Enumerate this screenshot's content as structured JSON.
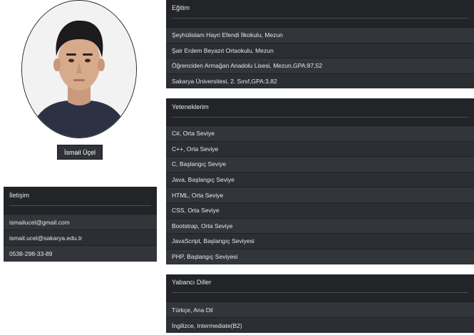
{
  "profile": {
    "name": "İsmail Üçel"
  },
  "egitim": {
    "title": "Eğitim",
    "items": [
      "Şeyhülislam Hayri Efendi İlkokulu, Mezun",
      "Şair Erdem Beyazıt Ortaokulu, Mezun",
      "Öğrenciden Armağan Anadolu Lisesi, Mezun,GPA:87,52",
      "Sakarya Üniversitesi, 2. Sınıf,GPA:3,82"
    ]
  },
  "yetenekler": {
    "title": "Yeteneklerim",
    "items": [
      "C#, Orta Seviye",
      "C++, Orta Seviye",
      "C, Başlangıç Seviye",
      "Java, Başlangıç Seviye",
      "HTML, Orta Seviye",
      "CSS, Orta Seviye",
      "Bootstrap, Orta Seviye",
      "JavaScript, Başlangıç Seviyesi",
      "PHP, Başlangıç Seviyesi"
    ]
  },
  "diller": {
    "title": "Yabancı Diller",
    "items": [
      "Türkçe, Ana Dil",
      "İngilizce, Intermediate(B2)"
    ]
  },
  "iletisim": {
    "title": "İletişim",
    "items": [
      "ismailucel@gmail.com",
      "ismail.ucel@sakarya.edu.tr",
      "0538-298-33-89"
    ]
  },
  "colors": {
    "card_bg": "#2b2e33",
    "header_bg": "#222428",
    "text": "#e8e8e8"
  }
}
